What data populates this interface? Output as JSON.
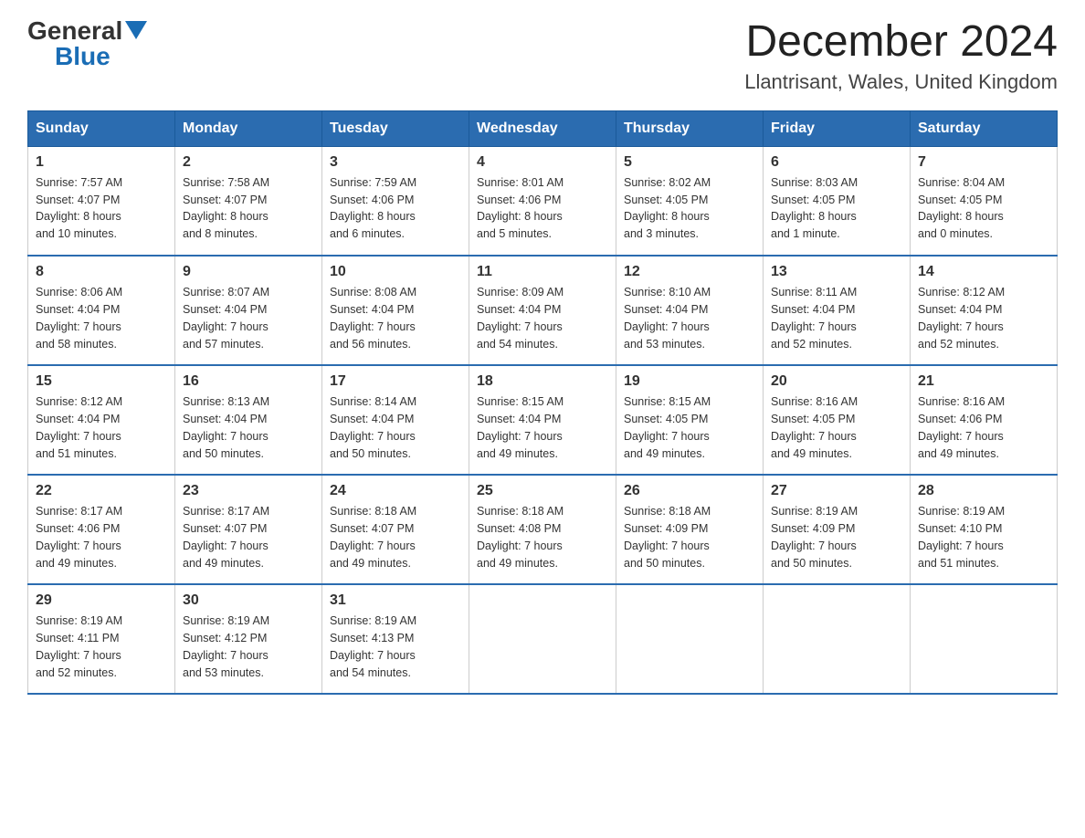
{
  "header": {
    "logo_general": "General",
    "logo_blue": "Blue",
    "title": "December 2024",
    "subtitle": "Llantrisant, Wales, United Kingdom"
  },
  "days_of_week": [
    "Sunday",
    "Monday",
    "Tuesday",
    "Wednesday",
    "Thursday",
    "Friday",
    "Saturday"
  ],
  "weeks": [
    [
      {
        "day": "1",
        "sunrise": "7:57 AM",
        "sunset": "4:07 PM",
        "daylight": "8 hours and 10 minutes."
      },
      {
        "day": "2",
        "sunrise": "7:58 AM",
        "sunset": "4:07 PM",
        "daylight": "8 hours and 8 minutes."
      },
      {
        "day": "3",
        "sunrise": "7:59 AM",
        "sunset": "4:06 PM",
        "daylight": "8 hours and 6 minutes."
      },
      {
        "day": "4",
        "sunrise": "8:01 AM",
        "sunset": "4:06 PM",
        "daylight": "8 hours and 5 minutes."
      },
      {
        "day": "5",
        "sunrise": "8:02 AM",
        "sunset": "4:05 PM",
        "daylight": "8 hours and 3 minutes."
      },
      {
        "day": "6",
        "sunrise": "8:03 AM",
        "sunset": "4:05 PM",
        "daylight": "8 hours and 1 minute."
      },
      {
        "day": "7",
        "sunrise": "8:04 AM",
        "sunset": "4:05 PM",
        "daylight": "8 hours and 0 minutes."
      }
    ],
    [
      {
        "day": "8",
        "sunrise": "8:06 AM",
        "sunset": "4:04 PM",
        "daylight": "7 hours and 58 minutes."
      },
      {
        "day": "9",
        "sunrise": "8:07 AM",
        "sunset": "4:04 PM",
        "daylight": "7 hours and 57 minutes."
      },
      {
        "day": "10",
        "sunrise": "8:08 AM",
        "sunset": "4:04 PM",
        "daylight": "7 hours and 56 minutes."
      },
      {
        "day": "11",
        "sunrise": "8:09 AM",
        "sunset": "4:04 PM",
        "daylight": "7 hours and 54 minutes."
      },
      {
        "day": "12",
        "sunrise": "8:10 AM",
        "sunset": "4:04 PM",
        "daylight": "7 hours and 53 minutes."
      },
      {
        "day": "13",
        "sunrise": "8:11 AM",
        "sunset": "4:04 PM",
        "daylight": "7 hours and 52 minutes."
      },
      {
        "day": "14",
        "sunrise": "8:12 AM",
        "sunset": "4:04 PM",
        "daylight": "7 hours and 52 minutes."
      }
    ],
    [
      {
        "day": "15",
        "sunrise": "8:12 AM",
        "sunset": "4:04 PM",
        "daylight": "7 hours and 51 minutes."
      },
      {
        "day": "16",
        "sunrise": "8:13 AM",
        "sunset": "4:04 PM",
        "daylight": "7 hours and 50 minutes."
      },
      {
        "day": "17",
        "sunrise": "8:14 AM",
        "sunset": "4:04 PM",
        "daylight": "7 hours and 50 minutes."
      },
      {
        "day": "18",
        "sunrise": "8:15 AM",
        "sunset": "4:04 PM",
        "daylight": "7 hours and 49 minutes."
      },
      {
        "day": "19",
        "sunrise": "8:15 AM",
        "sunset": "4:05 PM",
        "daylight": "7 hours and 49 minutes."
      },
      {
        "day": "20",
        "sunrise": "8:16 AM",
        "sunset": "4:05 PM",
        "daylight": "7 hours and 49 minutes."
      },
      {
        "day": "21",
        "sunrise": "8:16 AM",
        "sunset": "4:06 PM",
        "daylight": "7 hours and 49 minutes."
      }
    ],
    [
      {
        "day": "22",
        "sunrise": "8:17 AM",
        "sunset": "4:06 PM",
        "daylight": "7 hours and 49 minutes."
      },
      {
        "day": "23",
        "sunrise": "8:17 AM",
        "sunset": "4:07 PM",
        "daylight": "7 hours and 49 minutes."
      },
      {
        "day": "24",
        "sunrise": "8:18 AM",
        "sunset": "4:07 PM",
        "daylight": "7 hours and 49 minutes."
      },
      {
        "day": "25",
        "sunrise": "8:18 AM",
        "sunset": "4:08 PM",
        "daylight": "7 hours and 49 minutes."
      },
      {
        "day": "26",
        "sunrise": "8:18 AM",
        "sunset": "4:09 PM",
        "daylight": "7 hours and 50 minutes."
      },
      {
        "day": "27",
        "sunrise": "8:19 AM",
        "sunset": "4:09 PM",
        "daylight": "7 hours and 50 minutes."
      },
      {
        "day": "28",
        "sunrise": "8:19 AM",
        "sunset": "4:10 PM",
        "daylight": "7 hours and 51 minutes."
      }
    ],
    [
      {
        "day": "29",
        "sunrise": "8:19 AM",
        "sunset": "4:11 PM",
        "daylight": "7 hours and 52 minutes."
      },
      {
        "day": "30",
        "sunrise": "8:19 AM",
        "sunset": "4:12 PM",
        "daylight": "7 hours and 53 minutes."
      },
      {
        "day": "31",
        "sunrise": "8:19 AM",
        "sunset": "4:13 PM",
        "daylight": "7 hours and 54 minutes."
      },
      null,
      null,
      null,
      null
    ]
  ],
  "labels": {
    "sunrise": "Sunrise:",
    "sunset": "Sunset:",
    "daylight": "Daylight:"
  }
}
